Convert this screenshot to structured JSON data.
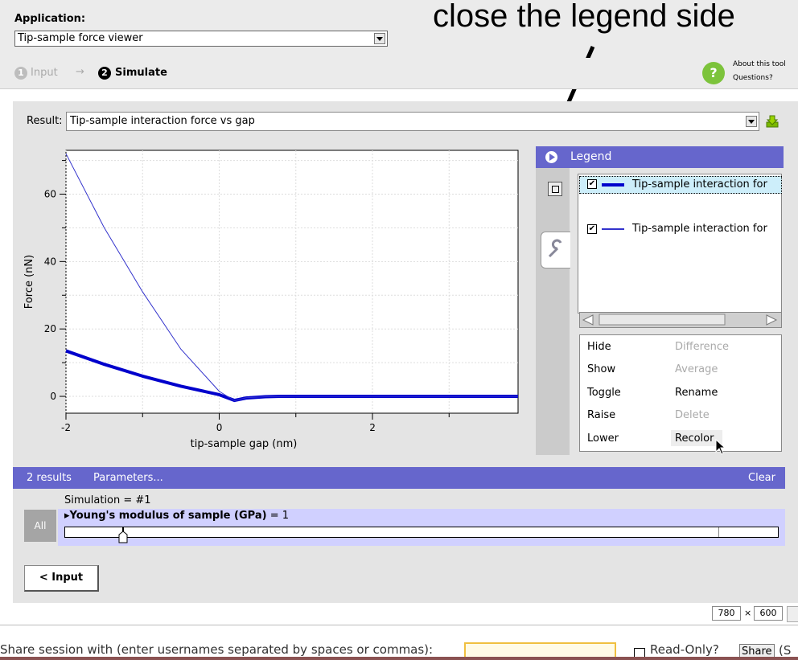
{
  "app_label": "Application:",
  "app_select": "Tip-sample force viewer",
  "annotation_text": "close the legend side",
  "steps": {
    "input": "Input",
    "arrow": "→",
    "simulate": "Simulate",
    "num1": "1",
    "num2": "2"
  },
  "about": {
    "line1": "About this tool",
    "line2": "Questions?"
  },
  "result_label": "Result:",
  "result_value": "Tip-sample interaction force vs gap",
  "chart_data": {
    "type": "line",
    "xlabel": "tip-sample gap (nm)",
    "ylabel": "Force (nN)",
    "xlim": [
      -2,
      3.9
    ],
    "ylim": [
      -5,
      73
    ],
    "x_ticks": [
      "-2",
      "0",
      "2"
    ],
    "y_ticks": [
      "0",
      "20",
      "40",
      "60"
    ],
    "grid": true,
    "series": [
      {
        "name": "Tip-sample interaction force",
        "style": "thick",
        "color": "#0000cc",
        "x": [
          -2,
          -1.5,
          -1,
          -0.5,
          0,
          0.2,
          0.35,
          0.6,
          0.8,
          1.2,
          2,
          3,
          3.9
        ],
        "y": [
          13.5,
          9.5,
          6.0,
          3.0,
          0.5,
          -1.2,
          -0.5,
          -0.1,
          0,
          0,
          0,
          0,
          0
        ]
      },
      {
        "name": "Tip-sample interaction force",
        "style": "thin",
        "color": "#3333cc",
        "x": [
          -2,
          -1.5,
          -1,
          -0.5,
          0,
          0.2,
          0.35,
          0.6,
          1,
          2,
          3,
          3.9
        ],
        "y": [
          72,
          50,
          31,
          14,
          1.5,
          -1.3,
          -0.4,
          -0.1,
          0,
          0,
          0,
          0
        ]
      }
    ]
  },
  "legend": {
    "title": "Legend",
    "items": [
      "Tip-sample interaction for",
      "Tip-sample interaction for"
    ],
    "menu_left": [
      "Hide",
      "Show",
      "Toggle",
      "Raise",
      "Lower"
    ],
    "menu_right": [
      "Difference",
      "Average",
      "Rename",
      "Delete",
      "Recolor"
    ]
  },
  "results_bar": {
    "count": "2 results",
    "params": "Parameters...",
    "clear": "Clear"
  },
  "simulation": {
    "label": "Simulation = #1",
    "param": "Young's modulus of sample (GPa)",
    "value": "= 1",
    "all": "All"
  },
  "input_button": "< Input",
  "size": {
    "w": "780",
    "x": "×",
    "h": "600"
  },
  "share": {
    "text": "Share session with (enter usernames separated by spaces or commas):",
    "readonly": "Read-Only?",
    "share_btn": "Share",
    "tail": "(S"
  },
  "colors": {
    "accent": "#6666cc",
    "panel": "#e4e4e4",
    "series1": "#0000cc",
    "series2": "#3333cc"
  }
}
